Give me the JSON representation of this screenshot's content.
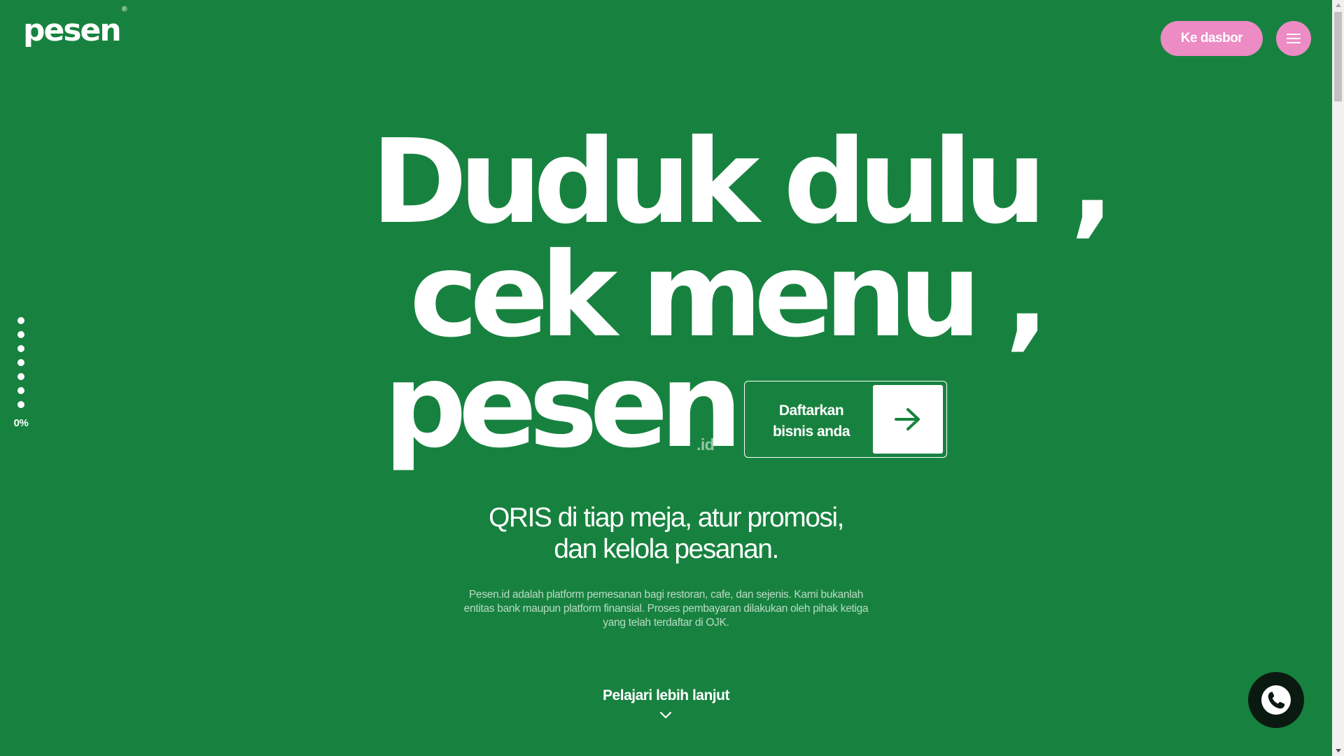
{
  "header": {
    "logo_text": "pesen",
    "logo_mark": "®",
    "dashboard_button_label": "Ke dasbor",
    "menu_icon": "hamburger-icon"
  },
  "progress": {
    "dot_count": 7,
    "label": "0%",
    "value": 0
  },
  "hero": {
    "line1": "Duduk dulu ,",
    "line2": "cek menu ,",
    "line3": "pesen",
    "suffix": ".id",
    "cta_label_line1": "Daftarkan",
    "cta_label_line2": "bisnis anda",
    "cta_icon": "arrow-right-icon"
  },
  "subheadline": {
    "line1": "QRIS di tiap meja, atur promosi,",
    "line2": "dan kelola pesanan."
  },
  "disclaimer": "Pesen.id adalah platform pemesanan bagi restoran, cafe, dan sejenis. Kami bukanlah entitas bank maupun platform finansial. Proses pembayaran dilakukan oleh pihak ketiga yang telah terdaftar di OJK.",
  "learn_more": {
    "label": "Pelajari lebih lanjut",
    "icon": "chevron-down-icon"
  },
  "whatsapp": {
    "icon": "whatsapp-icon"
  },
  "colors": {
    "background": "#17823F",
    "accent_pink": "#EC8BC4",
    "text": "#FFFFFF",
    "whatsapp_bg": "#0B1A10"
  }
}
